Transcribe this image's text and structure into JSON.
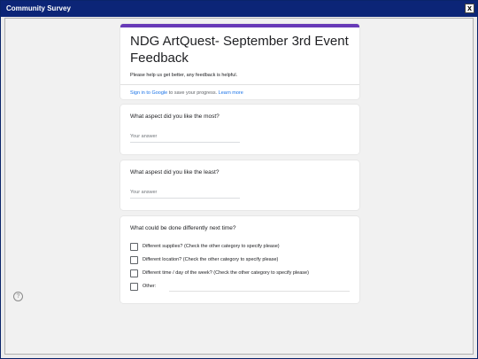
{
  "window": {
    "title": "Community Survey",
    "close_label": "x"
  },
  "form": {
    "accent_color": "#673ab7",
    "title": "NDG ArtQuest- September 3rd Event Feedback",
    "description": "Please help us get better, any feedback is helpful.",
    "signin_link": "Sign in to Google",
    "signin_text": " to save your progress. ",
    "learn_more": "Learn more",
    "questions": [
      {
        "title": "What aspect did you like the most?",
        "placeholder": "Your answer"
      },
      {
        "title": "What aspest did you like the least?",
        "placeholder": "Your answer"
      },
      {
        "title": "What could be done differently next time?",
        "options": [
          "Different supplies? (Check the other category to specify please)",
          "Different location? (Check the other category to specify please)",
          "Different time / day of the week? (Check the other category to specify please)",
          "Other:"
        ]
      }
    ]
  },
  "help_icon": "?"
}
